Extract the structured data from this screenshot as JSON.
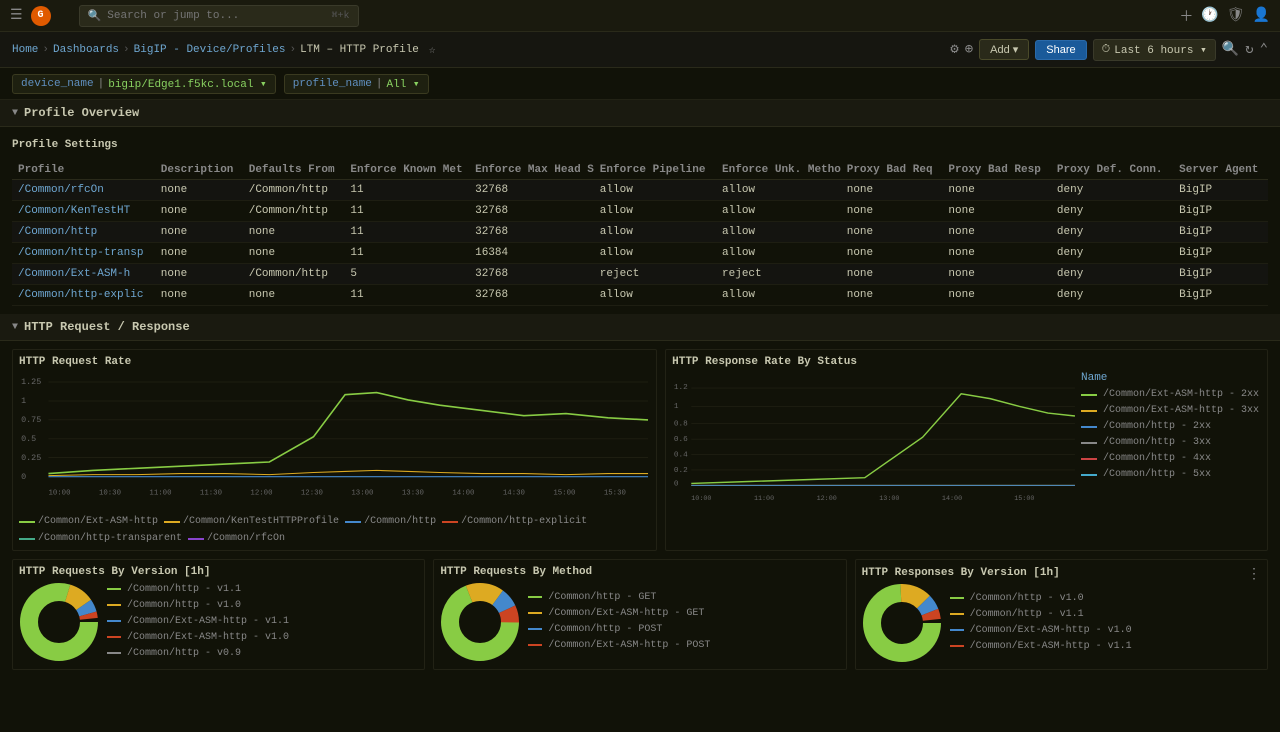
{
  "topbar": {
    "logo": "G",
    "search_placeholder": "Search or jump to...",
    "search_shortcut": "⌘+k",
    "icons": [
      "plus-icon",
      "clock-icon",
      "user-icon",
      "gear-icon"
    ]
  },
  "breadcrumb": {
    "items": [
      "Home",
      "Dashboards",
      "BigIP - Device/Profiles",
      "LTM – HTTP Profile"
    ]
  },
  "toolbar": {
    "add_label": "Add ▾",
    "share_label": "Share",
    "time_range": "Last 6 hours ▾",
    "zoom_in": "⊕",
    "refresh": "↻",
    "collapse": "⌃"
  },
  "filters": [
    {
      "key": "device_name",
      "value": "bigip/Edge1.f5kc.local ▾"
    },
    {
      "key": "profile_name",
      "value": "All ▾"
    }
  ],
  "profile_overview": {
    "section_title": "Profile Overview",
    "settings_label": "Profile Settings",
    "columns": [
      "Profile",
      "Description",
      "Defaults From",
      "Enforce Known Met",
      "Enforce Max Head S",
      "Enforce Pipeline",
      "Enforce Unk. Metho",
      "Proxy Bad Req",
      "Proxy Bad Resp",
      "Proxy Def. Conn.",
      "Server Agent"
    ],
    "rows": [
      [
        "/Common/rfcOn",
        "none",
        "/Common/http",
        "11",
        "32768",
        "allow",
        "allow",
        "none",
        "none",
        "deny",
        "BigIP"
      ],
      [
        "/Common/KenTestHT",
        "none",
        "/Common/http",
        "11",
        "32768",
        "allow",
        "allow",
        "none",
        "none",
        "deny",
        "BigIP"
      ],
      [
        "/Common/http",
        "none",
        "none",
        "11",
        "32768",
        "allow",
        "allow",
        "none",
        "none",
        "deny",
        "BigIP"
      ],
      [
        "/Common/http-transp",
        "none",
        "none",
        "11",
        "16384",
        "allow",
        "allow",
        "none",
        "none",
        "deny",
        "BigIP"
      ],
      [
        "/Common/Ext-ASM-h",
        "none",
        "/Common/http",
        "5",
        "32768",
        "reject",
        "reject",
        "none",
        "none",
        "deny",
        "BigIP"
      ],
      [
        "/Common/http-explic",
        "none",
        "none",
        "11",
        "32768",
        "allow",
        "allow",
        "none",
        "none",
        "deny",
        "BigIP"
      ]
    ]
  },
  "http_request_response": {
    "section_title": "HTTP Request / Response"
  },
  "request_rate_chart": {
    "title": "HTTP Request Rate",
    "y_ticks": [
      "1.25",
      "1",
      "0.75",
      "0.5",
      "0.25",
      "0"
    ],
    "x_ticks": [
      "10:00",
      "10:30",
      "11:00",
      "11:30",
      "12:00",
      "12:30",
      "13:00",
      "13:30",
      "14:00",
      "14:30",
      "15:00",
      "15:30"
    ],
    "legend": [
      {
        "label": "/Common/Ext-ASM-http",
        "color": "#88cc44"
      },
      {
        "label": "/Common/KenTestHTTPProfile",
        "color": "#ddaa22"
      },
      {
        "label": "/Common/http",
        "color": "#4488cc"
      },
      {
        "label": "/Common/http-explicit",
        "color": "#cc4422"
      },
      {
        "label": "/Common/http-transparent",
        "color": "#44aa88"
      },
      {
        "label": "/Common/rfcOn",
        "color": "#8844cc"
      }
    ]
  },
  "response_rate_chart": {
    "title": "HTTP Response Rate By Status",
    "y_ticks": [
      "1.2",
      "1",
      "0.8",
      "0.6",
      "0.4",
      "0.2",
      "0"
    ],
    "x_ticks": [
      "10:00",
      "11:00",
      "12:00",
      "13:00",
      "14:00",
      "15:00"
    ],
    "legend_title": "Name",
    "legend": [
      {
        "label": "/Common/Ext-ASM-http - 2xx",
        "color": "#88cc44"
      },
      {
        "label": "/Common/Ext-ASM-http - 3xx",
        "color": "#ddaa22"
      },
      {
        "label": "/Common/http - 2xx",
        "color": "#4488cc"
      },
      {
        "label": "/Common/http - 3xx",
        "color": "#888888"
      },
      {
        "label": "/Common/http - 4xx",
        "color": "#cc4444"
      },
      {
        "label": "/Common/http - 5xx",
        "color": "#44aacc"
      }
    ]
  },
  "requests_by_version": {
    "title": "HTTP Requests By Version [1h]",
    "legend": [
      {
        "label": "/Common/http - v1.1",
        "color": "#88cc44"
      },
      {
        "label": "/Common/http - v1.0",
        "color": "#ddaa22"
      },
      {
        "label": "/Common/Ext-ASM-http - v1.1",
        "color": "#4488cc"
      },
      {
        "label": "/Common/Ext-ASM-http - v1.0",
        "color": "#cc4422"
      },
      {
        "label": "/Common/http - v0.9",
        "color": "#888888"
      }
    ]
  },
  "requests_by_method": {
    "title": "HTTP Requests By Method",
    "legend": [
      {
        "label": "/Common/http - GET",
        "color": "#88cc44"
      },
      {
        "label": "/Common/Ext-ASM-http - GET",
        "color": "#ddaa22"
      },
      {
        "label": "/Common/http - POST",
        "color": "#4488cc"
      },
      {
        "label": "/Common/Ext-ASM-http - POST",
        "color": "#cc4422"
      }
    ]
  },
  "responses_by_version": {
    "title": "HTTP Responses By Version [1h]",
    "legend": [
      {
        "label": "/Common/http - v1.0",
        "color": "#88cc44"
      },
      {
        "label": "/Common/http - v1.1",
        "color": "#ddaa22"
      },
      {
        "label": "/Common/Ext-ASM-http - v1.0",
        "color": "#4488cc"
      },
      {
        "label": "/Common/Ext-ASM-http - v1.1",
        "color": "#cc4422"
      }
    ]
  }
}
